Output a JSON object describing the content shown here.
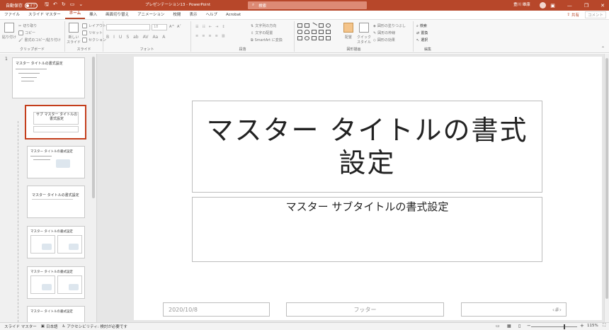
{
  "titlebar": {
    "autosave_label": "自動保存",
    "autosave_state": "オフ",
    "doc_title": "プレゼンテーション13 - PowerPoint",
    "search_placeholder": "検索",
    "user_name": "豊川 雄康",
    "accent": "#b7472a"
  },
  "tabs": [
    {
      "label": "ファイル"
    },
    {
      "label": "スライド マスター"
    },
    {
      "label": "ホーム"
    },
    {
      "label": "挿入"
    },
    {
      "label": "画面切り替え"
    },
    {
      "label": "アニメーション"
    },
    {
      "label": "校閲"
    },
    {
      "label": "表示"
    },
    {
      "label": "ヘルプ"
    },
    {
      "label": "Acrobat"
    }
  ],
  "share_label": "共有",
  "comment_label": "コメント",
  "ribbon": {
    "clipboard": {
      "label": "クリップボード",
      "paste": "貼り付け",
      "cut": "切り取り",
      "copy": "コピー",
      "format_painter": "書式のコピー/貼り付け"
    },
    "slides": {
      "label": "スライド",
      "new_slide": "新しい スライド",
      "layout": "レイアウト",
      "reset": "リセット",
      "section": "セクション"
    },
    "font": {
      "label": "フォント",
      "size": "18"
    },
    "paragraph": {
      "label": "段落",
      "text_direction": "文字列の方向",
      "align_text": "文字の配置",
      "smartart": "SmartArt に変換"
    },
    "drawing": {
      "label": "図形描画",
      "arrange": "配置",
      "quick_styles": "クイック スタイル",
      "fill": "図形の塗りつぶし",
      "outline": "図形の枠線",
      "effects": "図形の効果"
    },
    "editing": {
      "label": "編集",
      "find": "検索",
      "replace": "置換",
      "select": "選択"
    }
  },
  "thumbs": {
    "n1": "1",
    "t1_title": "マスター タイトルの書式設定",
    "t2_title": "サブ マスター タイトルの書式設定",
    "t4_title": "マスター タイトルの書式設定"
  },
  "slide": {
    "title": "マスター タイトルの書式設定",
    "subtitle": "マスター サブタイトルの書式設定",
    "date": "2020/10/8",
    "footer": "フッター",
    "page": "‹#›"
  },
  "status": {
    "view": "スライド マスター",
    "language": "日本語",
    "accessibility": "アクセシビリティ: 検討が必要です",
    "zoom": "115%"
  }
}
